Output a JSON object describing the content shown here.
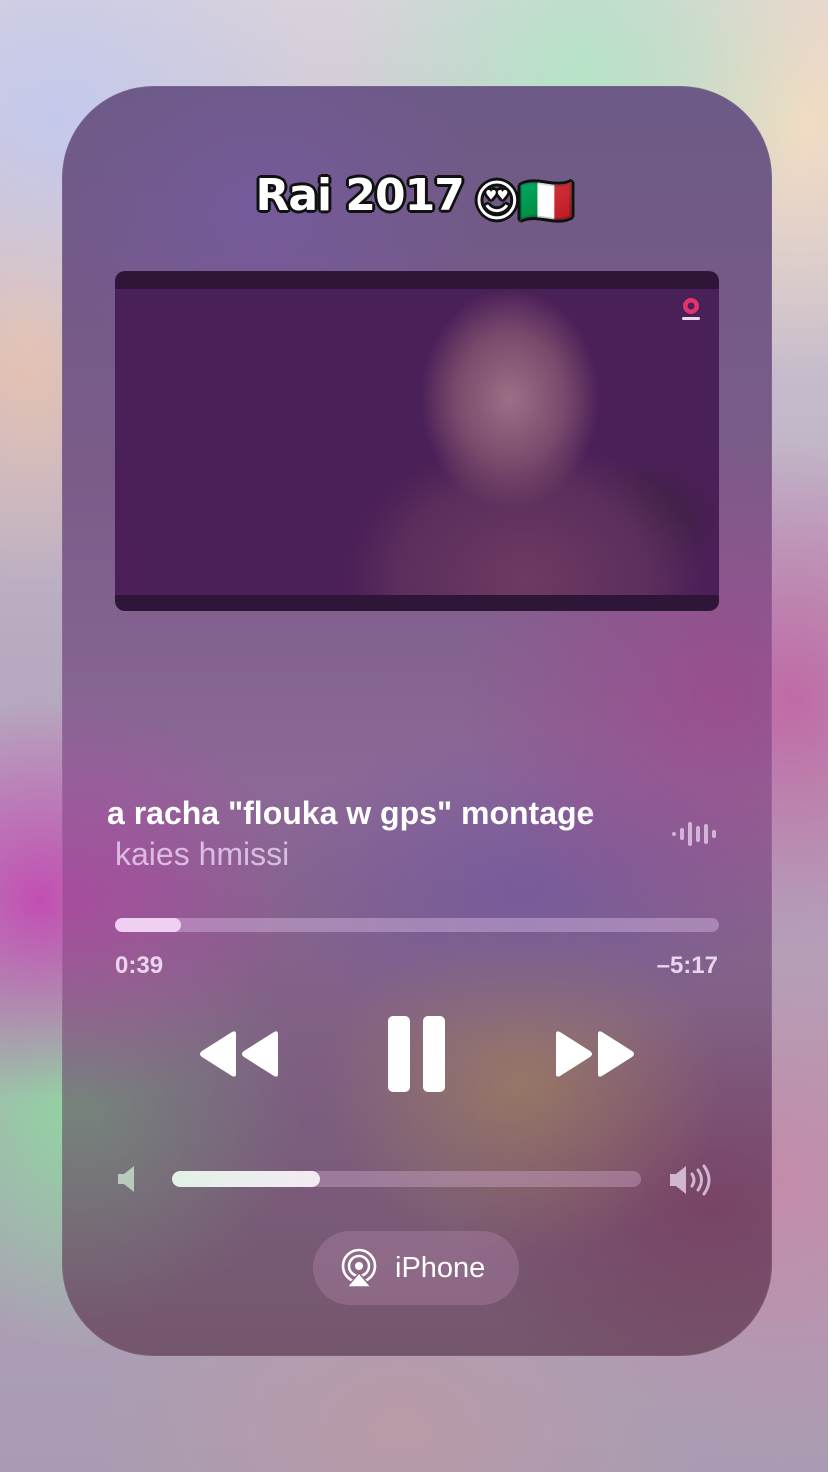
{
  "caption": {
    "text": "Rai 2017",
    "emoji": "😍🇮🇹"
  },
  "video": {
    "icon": "channel-logo-icon"
  },
  "now_playing": {
    "title": "a racha \"flouka w gps\" montage",
    "artist": "kaies hmissi",
    "icon": "waveform-icon"
  },
  "progress": {
    "elapsed": "0:39",
    "remaining": "–5:17",
    "fraction": 0.11
  },
  "controls": {
    "rewind_icon": "rewind-icon",
    "pause_icon": "pause-icon",
    "forward_icon": "fast-forward-icon"
  },
  "volume": {
    "fraction": 0.315,
    "low_icon": "speaker-low-icon",
    "high_icon": "speaker-high-icon"
  },
  "output": {
    "label": "iPhone",
    "icon": "airplay-icon"
  },
  "colors": {
    "accent": "#efd0f3",
    "text_primary": "#ffffff",
    "text_secondary": "#e8cdee"
  }
}
